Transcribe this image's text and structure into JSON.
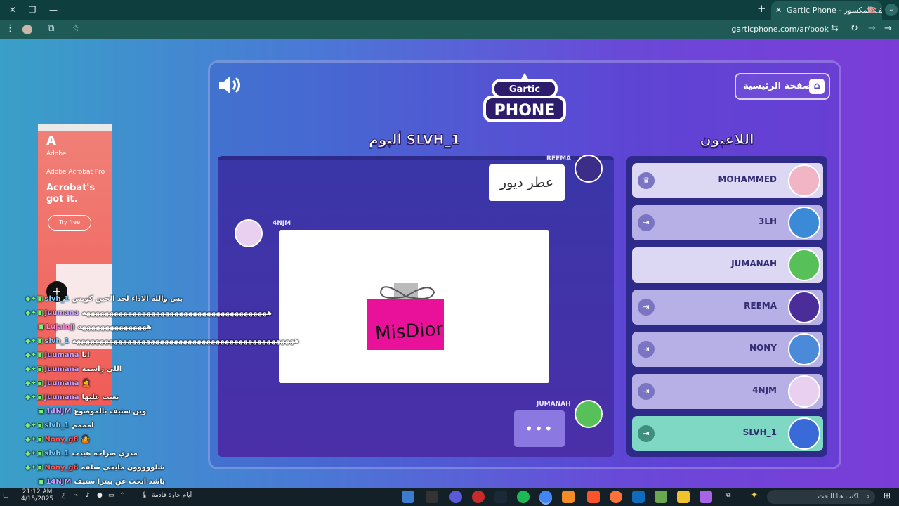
{
  "browser": {
    "tab_title": "Gartic Phone - الهاتف المكسور",
    "url": "garticphone.com/ar/book"
  },
  "game": {
    "home_button": "الصفحة الرئيسية",
    "logo_top": "Gartic",
    "logo_bottom": "PHONE",
    "album_title": "ألبوم SLVH_1",
    "players_title": "اللاعبون",
    "album": {
      "reply_user": "REEMA",
      "reply_text": "عطر ديور",
      "drawing_user": "4NJM",
      "drawing_text": "MisDior",
      "typing_user": "JUMANAH",
      "typing_text": "•••"
    },
    "players": [
      {
        "name": "MOHAMMED",
        "icon": "crown-icon"
      },
      {
        "name": "3LH",
        "icon": "exit-icon"
      },
      {
        "name": "JUMANAH",
        "icon": ""
      },
      {
        "name": "REEMA",
        "icon": "exit-icon"
      },
      {
        "name": "NONY",
        "icon": "exit-icon"
      },
      {
        "name": "4NJM",
        "icon": "exit-icon"
      },
      {
        "name": "SLVH_1",
        "icon": "exit-icon"
      }
    ]
  },
  "ad": {
    "brand": "Adobe",
    "product": "Adobe Acrobat Pro",
    "headline": "Acrobat's got it.",
    "cta": "Try free"
  },
  "chat": [
    {
      "user": "slvh_1",
      "text": "بس والله الاداء لحد الحين كويس"
    },
    {
      "user": "Juumana",
      "text": "ههههههههههههههههههههههههههههههههههههههههه"
    },
    {
      "user": "Lujainjj",
      "text": "هههههههههههههههه"
    },
    {
      "user": "slvh_1",
      "text": "ههههههههههههههههههههههههههههههههههههههههههههههههه"
    },
    {
      "user": "Juumana",
      "text": "انا"
    },
    {
      "user": "Juumana",
      "text": "اللي راسمه"
    },
    {
      "user": "Juumana",
      "text": "🤦"
    },
    {
      "user": "Juumana",
      "text": "تعبت عليها"
    },
    {
      "user": "14NJM",
      "text": "وين ستيف بالموضوع"
    },
    {
      "user": "slvh_1",
      "text": "امممم"
    },
    {
      "user": "Nony_g8",
      "text": "🤷"
    },
    {
      "user": "slvh_1",
      "text": "مدري صراحه هيدت"
    },
    {
      "user": "Nony_g8",
      "text": "شلووووون مايجي سلفه"
    },
    {
      "user": "14NJM",
      "text": "ياشد ابحث عن بيتزا ستيف"
    }
  ],
  "taskbar": {
    "search_placeholder": "اكتب هنا للبحث",
    "weather": "أيام حارة قادمة",
    "time": "21:12 AM",
    "date": "4/15/2025"
  }
}
